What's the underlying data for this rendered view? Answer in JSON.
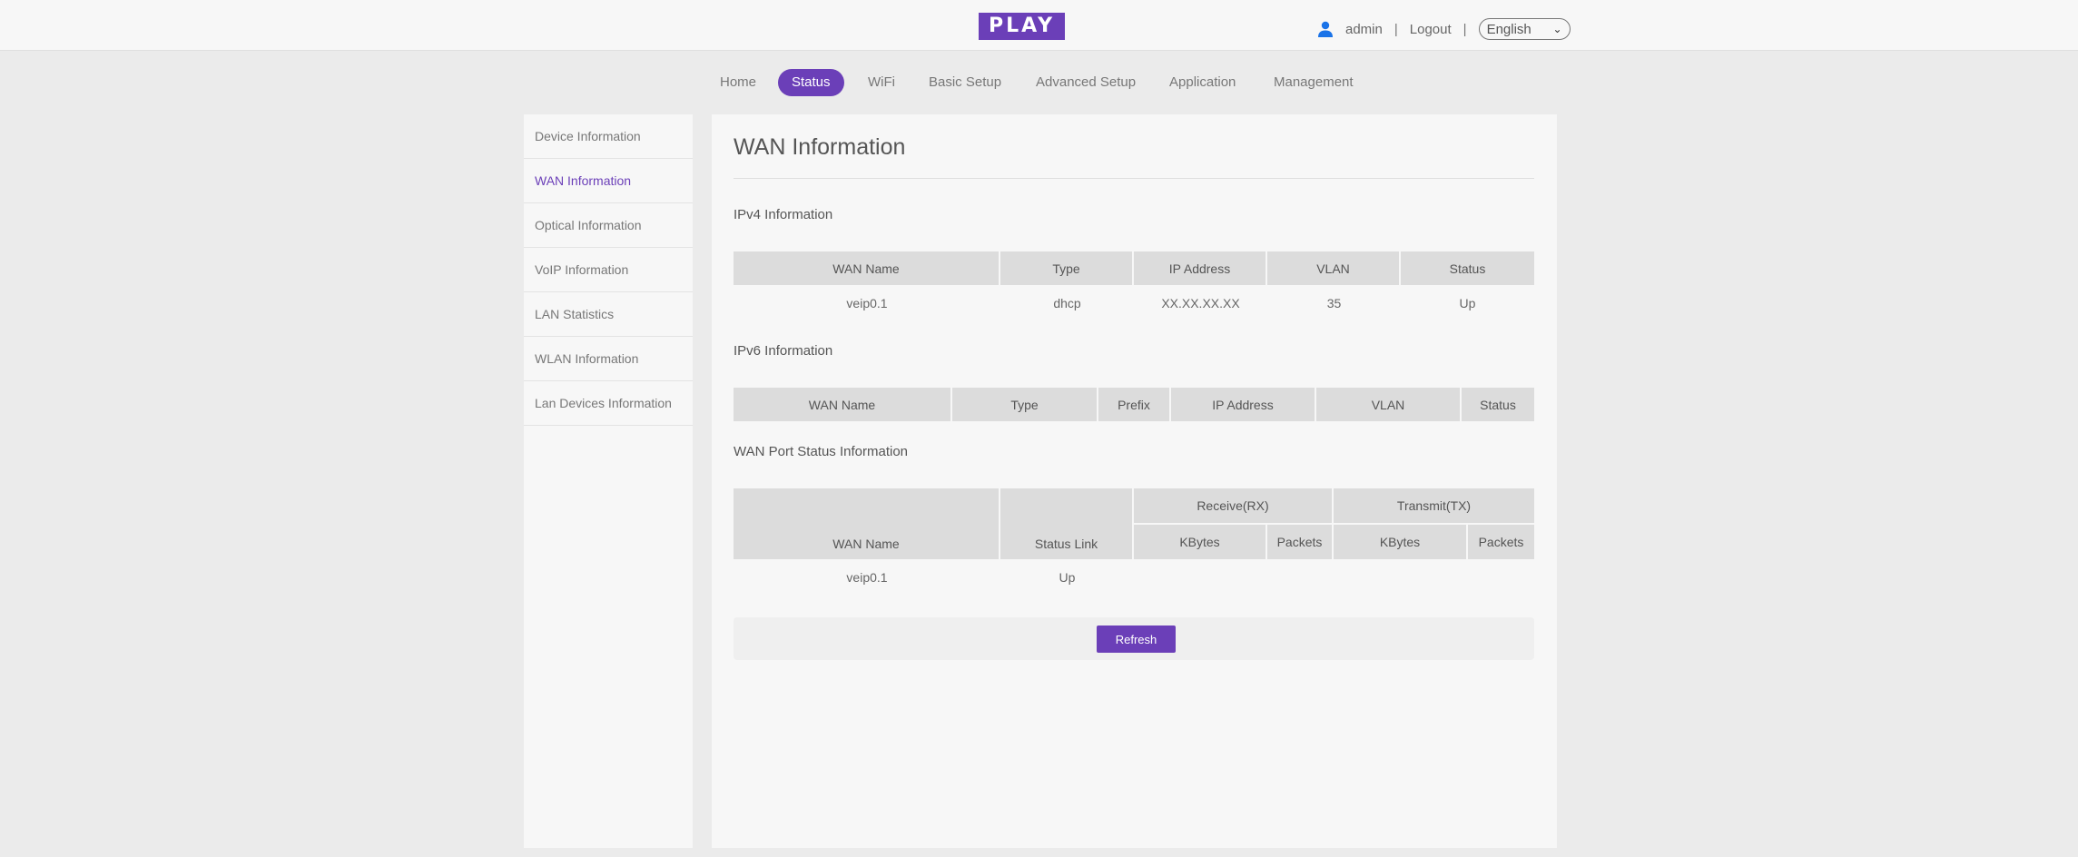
{
  "header": {
    "logo_text": "PLAY",
    "username": "admin",
    "logout_label": "Logout",
    "separator": "|",
    "language": "English"
  },
  "nav": {
    "items": [
      {
        "label": "Home"
      },
      {
        "label": "Status",
        "active": true
      },
      {
        "label": "WiFi"
      },
      {
        "label": "Basic Setup"
      },
      {
        "label": "Advanced Setup"
      },
      {
        "label": "Application"
      },
      {
        "label": "Management"
      }
    ]
  },
  "sidebar": {
    "items": [
      {
        "label": "Device Information"
      },
      {
        "label": "WAN Information",
        "active": true
      },
      {
        "label": "Optical Information"
      },
      {
        "label": "VoIP Information"
      },
      {
        "label": "LAN Statistics"
      },
      {
        "label": "WLAN Information"
      },
      {
        "label": "Lan Devices Information"
      }
    ]
  },
  "main": {
    "title": "WAN Information",
    "ipv4": {
      "title": "IPv4 Information",
      "headers": [
        "WAN Name",
        "Type",
        "IP Address",
        "VLAN",
        "Status"
      ],
      "rows": [
        [
          "veip0.1",
          "dhcp",
          "XX.XX.XX.XX",
          "35",
          "Up"
        ]
      ]
    },
    "ipv6": {
      "title": "IPv6 Information",
      "headers": [
        "WAN Name",
        "Type",
        "Prefix",
        "IP Address",
        "VLAN",
        "Status"
      ],
      "rows": []
    },
    "wanport": {
      "title": "WAN Port Status Information",
      "group_headers": [
        "Receive(RX)",
        "Transmit(TX)"
      ],
      "headers": [
        "WAN Name",
        "Status Link",
        "KBytes",
        "Packets",
        "KBytes",
        "Packets"
      ],
      "rows": [
        [
          "veip0.1",
          "Up",
          "",
          "",
          "",
          ""
        ]
      ]
    },
    "refresh_label": "Refresh"
  },
  "colors": {
    "accent": "#6b3fb8",
    "user_icon": "#1a73e8"
  }
}
